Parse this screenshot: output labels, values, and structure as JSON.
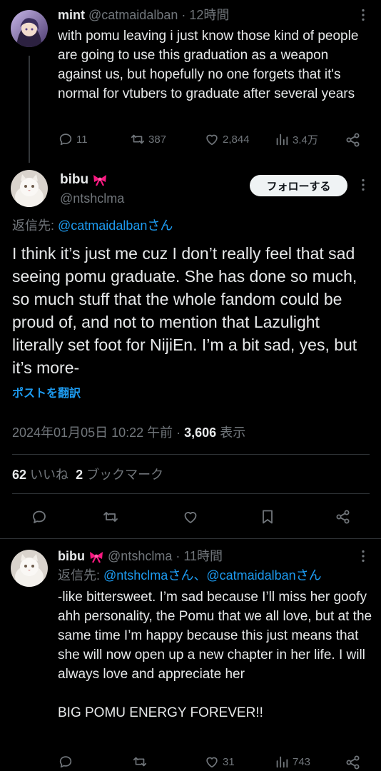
{
  "tweet1": {
    "name": "mint",
    "handle": "@catmaidalban",
    "time": "· 12時間",
    "text": "with pomu leaving i just know those kind of people are going to use this graduation as a weapon against us, but hopefully no one forgets that it's normal for vtubers to graduate after several years",
    "reply_count": "11",
    "retweet_count": "387",
    "like_count": "2,844",
    "view_count": "3.4万"
  },
  "main": {
    "name": "bibu",
    "handle": "@ntshclma",
    "follow_label": "フォローする",
    "reply_prefix": "返信先: ",
    "reply_to": "@catmaidalbanさん",
    "text": "I think it’s just me cuz I don’t really feel that sad seeing pomu graduate. She has done so much, so much stuff that the whole fandom could be proud of, and not to mention that Lazulight literally set foot for NijiEn. I’m a bit sad, yes, but it’s more-",
    "translate_label": "ポストを翻訳",
    "date": "2024年01月05日 10:22 午前",
    "views_sep": " · ",
    "views_count": "3,606",
    "views_label": " 表示",
    "likes_count": "62",
    "likes_label": "いいね",
    "bookmarks_count": "2",
    "bookmarks_label": "ブックマーク"
  },
  "tweet3": {
    "name": "bibu",
    "handle": "@ntshclma",
    "time": "· 11時間",
    "reply_prefix": "返信先: ",
    "reply_to": "@ntshclmaさん、@catmaidalbanさん",
    "text": "-like bittersweet. I’m sad because I’ll miss her goofy ahh personality, the Pomu that we all love, but at the same time I’m happy because this just means that she will now open up a new chapter in her life. I will always love and appreciate her\n\nBIG POMU ENERGY FOREVER!!",
    "like_count": "31",
    "view_count": "743"
  },
  "icons": {
    "reply": "reply-icon",
    "retweet": "retweet-icon",
    "like": "heart-icon",
    "views": "views-icon",
    "share": "share-icon",
    "bookmark": "bookmark-icon",
    "more": "more-icon",
    "ribbon": "ribbon-emoji-icon"
  },
  "colors": {
    "background": "#000000",
    "text": "#e7e9ea",
    "muted": "#71767b",
    "link": "#1d9bf0",
    "divider": "#2f3336",
    "ribbon": "#f91880"
  }
}
